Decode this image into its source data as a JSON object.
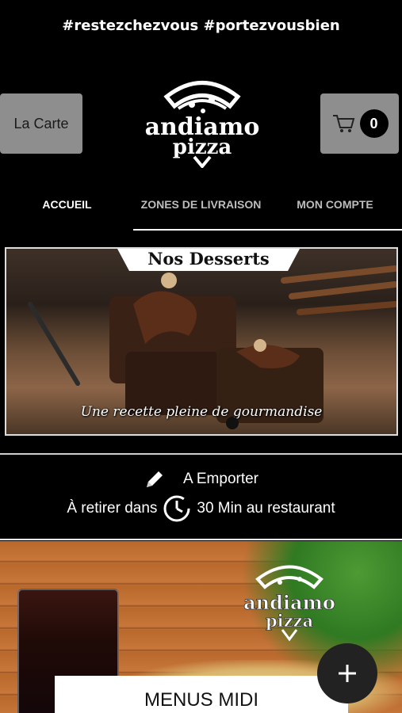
{
  "header": {
    "hashtag": "#restezchezvous #portezvousbien",
    "menu_button_label": "La Carte",
    "cart_count": "0",
    "logo_text_line1": "andiamo",
    "logo_text_line2": "pizza"
  },
  "tabs": [
    {
      "label": "ACCUEIL",
      "active": true
    },
    {
      "label": "ZONES DE LIVRAISON",
      "active": false
    },
    {
      "label": "MON COMPTE",
      "active": false
    }
  ],
  "banner": {
    "title": "Nos Desserts",
    "subtitle": "Une recette pleine de gourmandise"
  },
  "order_info": {
    "mode_label": "A Emporter",
    "pickup_prefix": "À retirer dans",
    "pickup_suffix": "30 Min au restaurant"
  },
  "promo": {
    "logo_text_line1": "andiamo",
    "logo_text_line2": "pizza",
    "card_label": "MENUS MIDI"
  },
  "colors": {
    "background": "#000000",
    "button_grey": "#8e8e8e",
    "text_white": "#ffffff"
  }
}
